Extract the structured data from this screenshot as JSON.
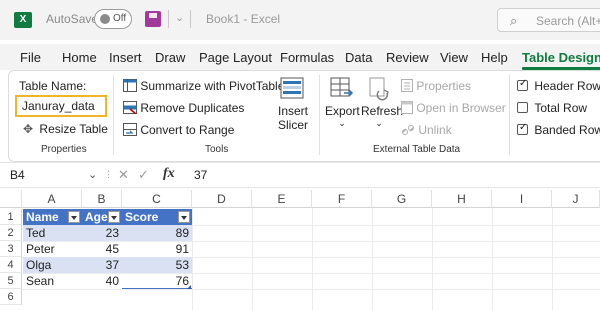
{
  "titlebar": {
    "logo": "X",
    "autosave_label": "AutoSave",
    "toggle_label": "Off",
    "qat_dropdown": "⌄",
    "book_title": "Book1  -  Excel",
    "search_placeholder": "Search (Alt+"
  },
  "tabs": [
    "File",
    "Home",
    "Insert",
    "Draw",
    "Page Layout",
    "Formulas",
    "Data",
    "Review",
    "View",
    "Help",
    "Table Design"
  ],
  "active_tab": "Table Design",
  "ribbon": {
    "properties": {
      "table_name_label": "Table Name:",
      "table_name_value": "Januray_data",
      "resize_table": "Resize Table",
      "group_label": "Properties"
    },
    "tools": {
      "summarize": "Summarize with PivotTable",
      "remove_duplicates": "Remove Duplicates",
      "convert_to_range": "Convert to Range",
      "insert_slicer_line1": "Insert",
      "insert_slicer_line2": "Slicer",
      "group_label": "Tools"
    },
    "external": {
      "export": "Export",
      "refresh": "Refresh",
      "properties": "Properties",
      "open_in_browser": "Open in Browser",
      "unlink": "Unlink",
      "group_label": "External Table Data"
    },
    "style_options": {
      "header_row": "Header Row",
      "total_row": "Total Row",
      "banded_rows": "Banded Rows",
      "header_row_checked": true,
      "total_row_checked": false,
      "banded_rows_checked": true
    }
  },
  "formula_bar": {
    "name_box": "B4",
    "cancel_icon": "✕",
    "enter_icon": "✓",
    "fx": "fx",
    "value": "37"
  },
  "sheet": {
    "columns": [
      "A",
      "B",
      "C",
      "D",
      "E",
      "F",
      "G",
      "H",
      "I",
      "J"
    ],
    "rows": [
      "1",
      "2",
      "3",
      "4",
      "5",
      "6"
    ],
    "table": {
      "headers": [
        "Name",
        "Age",
        "Score"
      ],
      "rows": [
        [
          "Ted",
          "23",
          "89"
        ],
        [
          "Peter",
          "45",
          "91"
        ],
        [
          "Olga",
          "37",
          "53"
        ],
        [
          "Sean",
          "40",
          "76"
        ]
      ]
    }
  },
  "colors": {
    "excel_green": "#107c41",
    "table_header": "#4472c4",
    "table_band": "#d9e1f2",
    "name_highlight": "#f0b429"
  }
}
